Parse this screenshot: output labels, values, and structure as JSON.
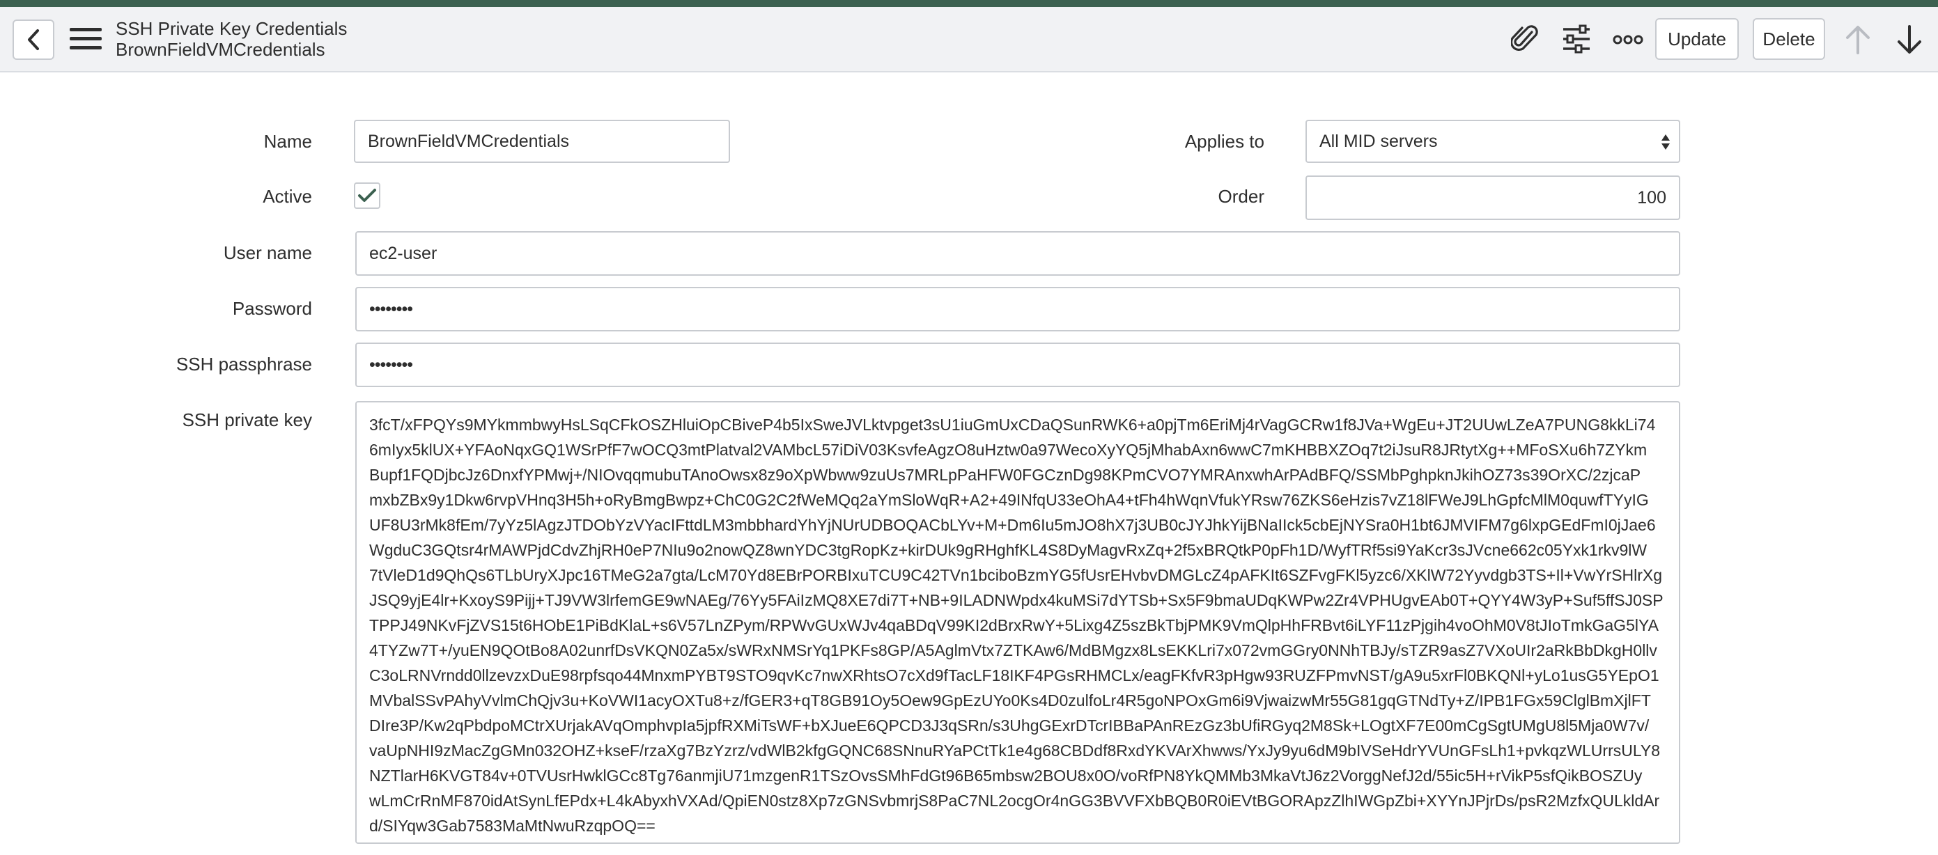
{
  "header": {
    "title": "SSH Private Key Credentials",
    "subtitle": "BrownFieldVMCredentials",
    "update_label": "Update",
    "delete_label": "Delete"
  },
  "icons": {
    "back": "chevron-left-icon",
    "menu": "hamburger-menu-icon",
    "attach": "paperclip-icon",
    "personalize": "sliders-icon",
    "more": "more-options-icon",
    "prev": "arrow-up-icon",
    "next": "arrow-down-icon",
    "check": "checkmark-icon",
    "select": "select-arrows-icon"
  },
  "colors": {
    "accent_stripe": "#3c6150",
    "check": "#3c6150",
    "header_bg": "#f1f2f4"
  },
  "form": {
    "name": {
      "label": "Name",
      "value": "BrownFieldVMCredentials"
    },
    "applies_to": {
      "label": "Applies to",
      "value": "All MID servers"
    },
    "active": {
      "label": "Active",
      "checked": true
    },
    "order": {
      "label": "Order",
      "value": "100"
    },
    "user_name": {
      "label": "User name",
      "value": "ec2-user"
    },
    "password": {
      "label": "Password",
      "value": "••••••••"
    },
    "ssh_passphrase": {
      "label": "SSH passphrase",
      "value": "••••••••"
    },
    "ssh_private_key": {
      "label": "SSH private key",
      "lines": [
        "3fcT/xFPQYs9MYkmmbwyHsLSqCFkOSZHluiOpCBiveP4b5IxSweJVLktvpget3sU1iuGmUxCDaQSunRWK6+a0pjTm6EriMj4rVagGCRw1f8JVa+WgEu+JT2UUwLZeA7PUNG8kkLi74",
        "6mIyx5klUX+YFAoNqxGQ1WSrPfF7wOCQ3mtPlatval2VAMbcL57iDiV03KsvfeAgzO8uHztw0a97WecoXyYQ5jMhabAxn6wwC7mKHBBXZOq7t2iJsuR8JRtytXg++MFoSXu6h7ZYkm",
        "Bupf1FQDjbcJz6DnxfYPMwj+/NIOvqqmubuTAnoOwsx8z9oXpWbww9zuUs7MRLpPaHFW0FGCznDg98KPmCVO7YMRAnxwhArPAdBFQ/SSMbPghpknJkihOZ73s39OrXC/2zjcaP",
        "mxbZBx9y1Dkw6rvpVHnq3H5h+oRyBmgBwpz+ChC0G2C2fWeMQq2aYmSloWqR+A2+49INfqU33eOhA4+tFh4hWqnVfukYRsw76ZKS6eHzis7vZ18lFWeJ9LhGpfcMlM0quwfTYyIG",
        "UF8U3rMk8fEm/7yYz5lAgzJTDObYzVYacIFttdLM3mbbhardYhYjNUrUDBOQACbLYv+M+Dm6Iu5mJO8hX7j3UB0cJYJhkYijBNaIIck5cbEjNYSra0H1bt6JMVIFM7g6lxpGEdFmI0jJae6",
        "WgduC3GQtsr4rMAWPjdCdvZhjRH0eP7NIu9o2nowQZ8wnYDC3tgRopKz+kirDUk9gRHghfKL4S8DyMagvRxZq+2f5xBRQtkP0pFh1D/WyfTRf5si9YaKcr3sJVcne662c05Yxk1rkv9lW",
        "7tVleD1d9QhQs6TLbUryXJpc16TMeG2a7gta/LcM70Yd8EBrPORBIxuTCU9C42TVn1bciboBzmYG5fUsrEHvbvDMGLcZ4pAFKIt6SZFvgFKl5yzc6/XKlW72Yyvdgb3TS+Il+VwYrSHlrXg",
        "JSQ9yjE4lr+KxoyS9Pijj+TJ9VW3lrfemGE9wNAEg/76Yy5FAiIzMQ8XE7di7T+NB+9ILADNWpdx4kuMSi7dYTSb+Sx5F9bmaUDqKWPw2Zr4VPHUgvEAb0T+QYY4W3yP+Suf5ffSJ0SP",
        "TPPJ49NKvFjZVS15t6HObE1PiBdKlaL+s6V57LnZPym/RPWvGUxWJv4qaBDqV99KI2dBrxRwY+5Lixg4Z5szBkTbjPMK9VmQlpHhFRBvt6iLYF11zPjgih4voOhM0V8tJIoTmkGaG5lYA",
        "4TYZw7T+/yuEN9QOtBo8A02unrfDsVKQN0Za5x/sWRxNMSrYq1PKFs8GP/A5AglmVtx7ZTKAw6/MdBMgzx8LsEKKLri7x072vmGGry0NNhTBJy/sTZR9asZ7VXoUIr2aRkBbDkgH0llv",
        "C3oLRNVrndd0llzevzxDuE98rpfsqo44MnxmPYBT9STO9qvKc7nwXRhtsO7cXd9fTacLF18IKF4PGsRHMCLx/eagFKfvR3pHgw93RUZFPmvNST/gA9u5xrFl0BKQNl+yLo1usG5YEpO1",
        "MVbalSSvPAhyVvlmChQjv3u+KoVWI1acyOXTu8+z/fGER3+qT8GB91Oy5Oew9GpEzUYo0Ks4D0zulfoLr4R5goNPOxGm6i9VjwaizwMr55G81gqGTNdTy+Z/IPB1FGx59ClglBmXjlFT",
        "DIre3P/Kw2qPbdpoMCtrXUrjakAVqOmphvpIa5jpfRXMiTsWF+bXJueE6QPCD3J3qSRn/s3UhgGExrDTcrIBBaPAnREzGz3bUfiRGyq2M8Sk+LOgtXF7E00mCgSgtUMgU8l5Mja0W7v/",
        "vaUpNHI9zMacZgGMn032OHZ+kseF/rzaXg7BzYzrz/vdWlB2kfgGQNC68SNnuRYaPCtTk1e4g68CBDdf8RxdYKVArXhwws/YxJy9yu6dM9bIVSeHdrYVUnGFsLh1+pvkqzWLUrrsULY8",
        "NZTlarH6KVGT84v+0TVUsrHwklGCc8Tg76anmjiU71mzgenR1TSzOvsSMhFdGt96B65mbsw2BOU8x0O/voRfPN8YkQMMb3MkaVtJ6z2VorggNefJ2d/55ic5H+rVikP5sfQikBOSZUy",
        "wLmCrRnMF870idAtSynLfEPdx+L4kAbyxhVXAd/QpiEN0stz8Xp7zGNSvbmrjS8PaC7NL2ocgOr4nGG3BVVFXbBQB0R0iEVtBGORApzZlhIWGpZbi+XYYnJPjrDs/psR2MzfxQULkldAr",
        "d/SIYqw3Gab7583MaMtNwuRzqpOQ=="
      ]
    }
  }
}
